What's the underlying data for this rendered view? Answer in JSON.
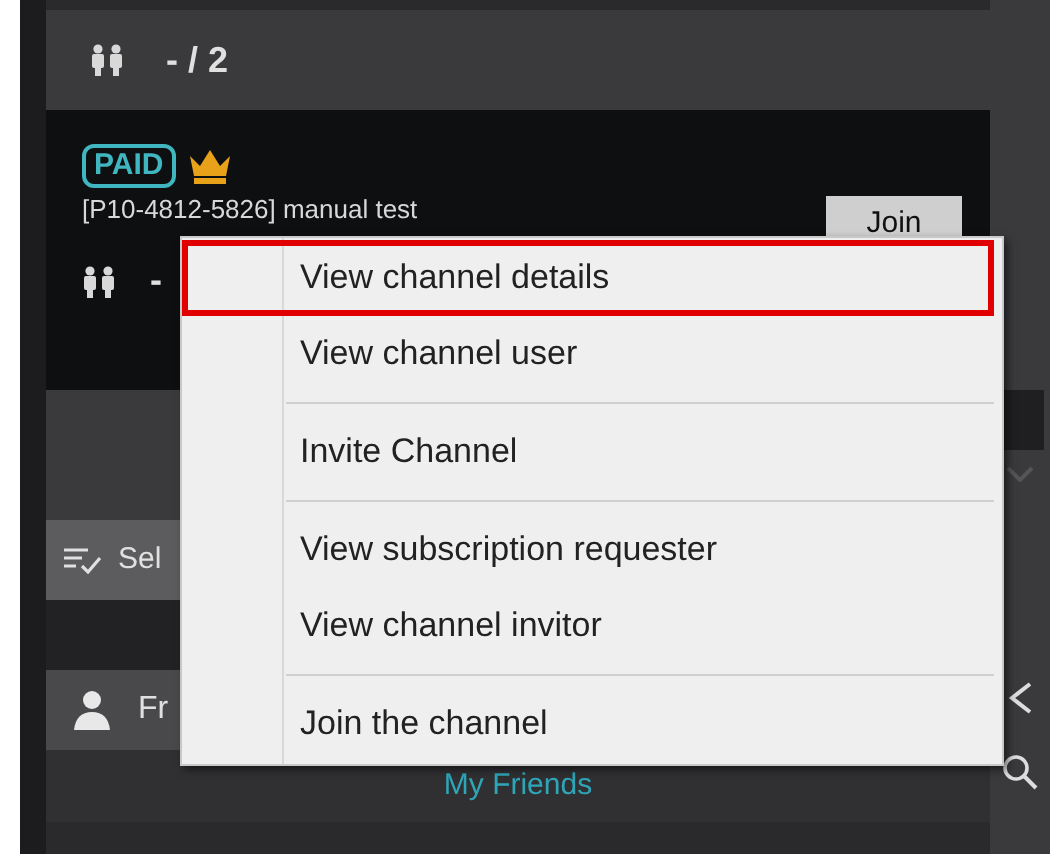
{
  "room": {
    "member_count": "- / 2"
  },
  "channel": {
    "badge": "PAID",
    "title": "[P10-4812-5826] manual test",
    "join_button": "Join",
    "member_count": "-"
  },
  "toolbar": {
    "label": "Sel"
  },
  "friends_panel": {
    "title": "Fr",
    "tab": "My Friends"
  },
  "context_menu": {
    "items": [
      {
        "label": "View channel details",
        "selected": true,
        "separator_before": false
      },
      {
        "label": "View channel user",
        "selected": false,
        "separator_before": false
      },
      {
        "label": "Invite Channel",
        "selected": false,
        "separator_before": true
      },
      {
        "label": "View subscription requester",
        "selected": false,
        "separator_before": true
      },
      {
        "label": "View channel invitor",
        "selected": false,
        "separator_before": false
      },
      {
        "label": "Join the channel",
        "selected": false,
        "separator_before": true
      }
    ]
  }
}
